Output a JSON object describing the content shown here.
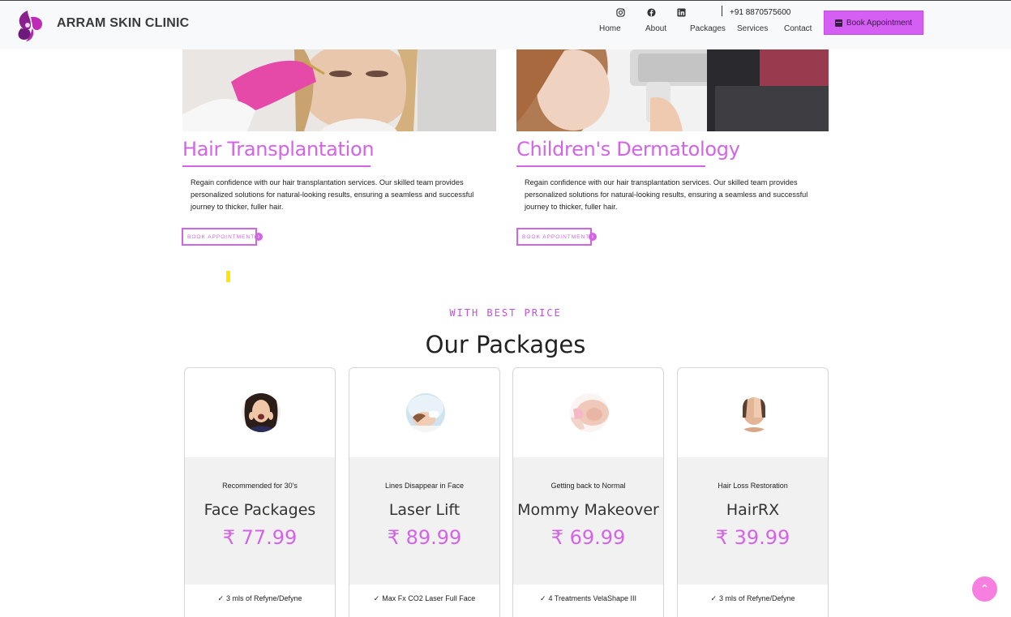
{
  "header": {
    "brand": "ARRAM SKIN CLINIC",
    "phone": "+91 8870575600",
    "social": [
      "instagram-icon",
      "facebook-icon",
      "linkedin-icon"
    ],
    "nav": [
      "Home",
      "About",
      "Packages",
      "Services",
      "Contact"
    ],
    "book_label": "Book Appointment"
  },
  "services": [
    {
      "title": "Hair Transplantation",
      "description": "Regain confidence with our hair transplantation services. Our skilled team provides personalized solutions for natural-looking results, ensuring a seamless and successful journey to thicker, fuller hair.",
      "button": "BOOK APPOINTMENT"
    },
    {
      "title": "Children's Dermatology",
      "description": "Regain confidence with our hair transplantation services. Our skilled team provides personalized solutions for natural-looking results, ensuring a seamless and successful journey to thicker, fuller hair.",
      "button": "BOOK APPOINTMENT"
    }
  ],
  "packages_section": {
    "eyebrow": "WITH BEST PRICE",
    "title": "Our Packages",
    "items": [
      {
        "subtitle": "Recommended for 30's",
        "name": "Face Packages",
        "price": "₹ 77.99",
        "feature": "3 mls of Refyne/Defyne"
      },
      {
        "subtitle": "Lines Disappear in Face",
        "name": "Laser Lift",
        "price": "₹ 89.99",
        "feature": "Max Fx CO2 Laser Full Face"
      },
      {
        "subtitle": "Getting back to Normal",
        "name": "Mommy Makeover",
        "price": "₹ 69.99",
        "feature": "4 Treatments VelaShape III"
      },
      {
        "subtitle": "Hair Loss Restoration",
        "name": "HairRX",
        "price": "₹ 39.99",
        "feature": "3 mls of Refyne/Defyne"
      }
    ]
  },
  "colors": {
    "accent": "#d364e8",
    "button": "#d55ef3",
    "scroll_top": "#f77fe0"
  }
}
